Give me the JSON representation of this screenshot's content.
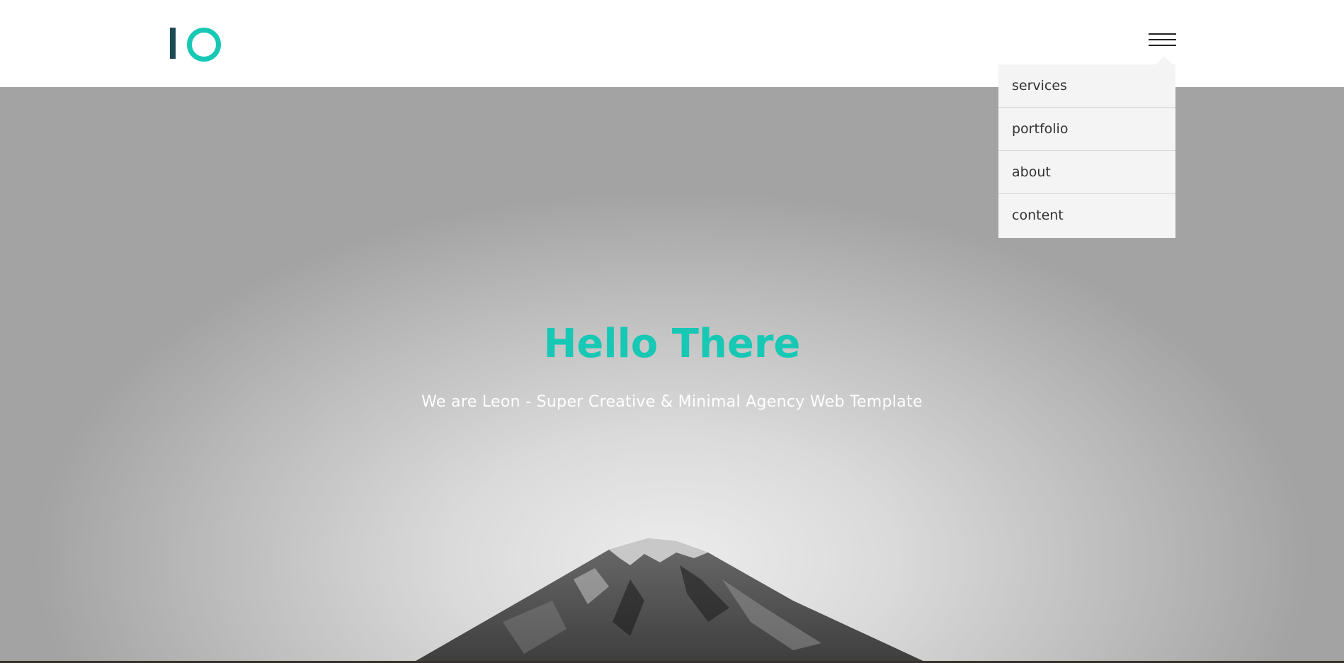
{
  "header": {
    "logo_name": "io-logo",
    "menu_icon": "hamburger-menu-icon"
  },
  "menu": {
    "items": [
      {
        "label": "services"
      },
      {
        "label": "portfolio"
      },
      {
        "label": "about"
      },
      {
        "label": "content"
      }
    ]
  },
  "hero": {
    "title": "Hello There",
    "subtitle": "We are Leon - Super Creative & Minimal Agency Web Template"
  },
  "colors": {
    "accent": "#17c8b5",
    "logo_dark": "#1e4a54",
    "menu_bg": "#f4f4f4"
  }
}
